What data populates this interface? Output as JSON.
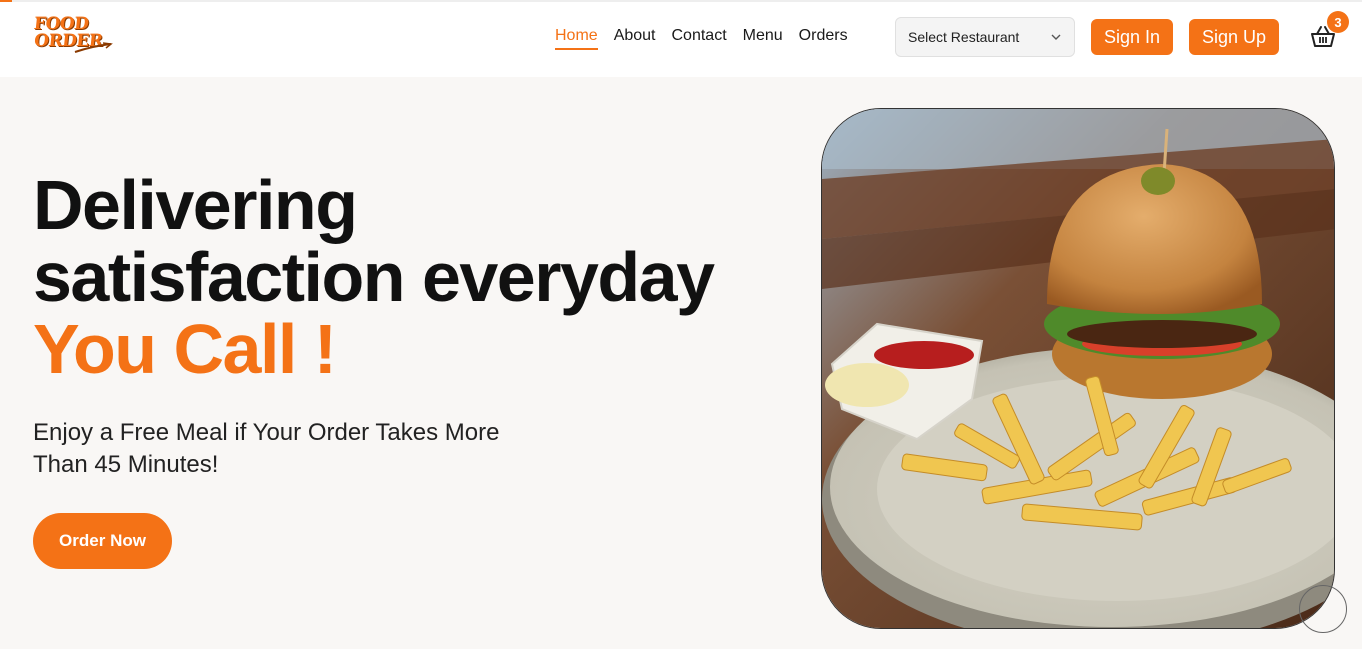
{
  "logo": {
    "line1": "FOOD",
    "line2": "ORDER"
  },
  "nav": [
    {
      "label": "Home",
      "active": true
    },
    {
      "label": "About",
      "active": false
    },
    {
      "label": "Contact",
      "active": false
    },
    {
      "label": "Menu",
      "active": false
    },
    {
      "label": "Orders",
      "active": false
    }
  ],
  "restaurant_select": {
    "selected": "Select Restaurant"
  },
  "auth": {
    "sign_in": "Sign In",
    "sign_up": "Sign Up"
  },
  "cart": {
    "count": "3",
    "icon": "basket-icon"
  },
  "hero": {
    "headline_line1": "Delivering",
    "headline_line2": "satisfaction everyday",
    "headline_accent": "You Call !",
    "subtext": "Enjoy a Free Meal if Your Order Takes More Than 45 Minutes!",
    "cta": "Order Now",
    "image": "burger-and-fries-photo"
  },
  "colors": {
    "accent": "#f47216",
    "background": "#f9f7f5",
    "text": "#111111"
  }
}
